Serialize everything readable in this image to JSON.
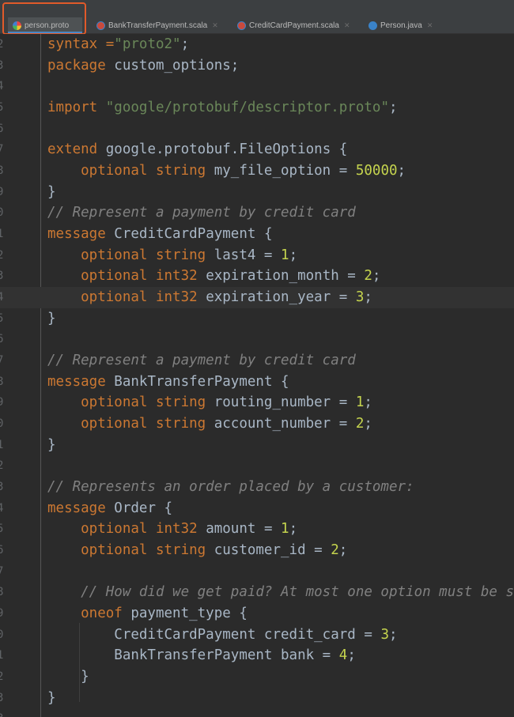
{
  "tabs": [
    {
      "label": "person.proto",
      "icon": "protobuf-file-icon",
      "active": true
    },
    {
      "label": "BankTransferPayment.scala",
      "icon": "scala-file-icon",
      "active": false
    },
    {
      "label": "CreditCardPayment.scala",
      "icon": "scala-file-icon",
      "active": false
    },
    {
      "label": "Person.java",
      "icon": "java-class-icon",
      "active": false
    }
  ],
  "editor": {
    "line_numbers": [
      "2",
      "3",
      "4",
      "5",
      "6",
      "7",
      "8",
      "9",
      "0",
      "1",
      "2",
      "3",
      "4",
      "5",
      "6",
      "7",
      "8",
      "9",
      "0",
      "1",
      "2",
      "3",
      "4",
      "5",
      "6",
      "7",
      "8",
      "9",
      "0",
      "1",
      "2",
      "3",
      "3"
    ],
    "lines": [
      [
        {
          "t": "syntax =",
          "c": "kw"
        },
        {
          "t": "\"proto2\"",
          "c": "str"
        },
        {
          "t": ";",
          "c": ""
        }
      ],
      [
        {
          "t": "package ",
          "c": "kw"
        },
        {
          "t": "custom_options;",
          "c": ""
        }
      ],
      [],
      [
        {
          "t": "import ",
          "c": "kw"
        },
        {
          "t": "\"google/protobuf/descriptor.proto\"",
          "c": "str"
        },
        {
          "t": ";",
          "c": ""
        }
      ],
      [],
      [
        {
          "t": "extend ",
          "c": "kw"
        },
        {
          "t": "google.protobuf.FileOptions {",
          "c": ""
        }
      ],
      [
        {
          "t": "    optional string ",
          "c": "kw"
        },
        {
          "t": "my_file_option = ",
          "c": ""
        },
        {
          "t": "50000",
          "c": "num-g"
        },
        {
          "t": ";",
          "c": ""
        }
      ],
      [
        {
          "t": "}",
          "c": ""
        }
      ],
      [
        {
          "t": "// Represent a payment by credit card",
          "c": "cm"
        }
      ],
      [
        {
          "t": "message ",
          "c": "kw"
        },
        {
          "t": "CreditCardPayment {",
          "c": ""
        }
      ],
      [
        {
          "t": "    optional string ",
          "c": "kw"
        },
        {
          "t": "last4 = ",
          "c": ""
        },
        {
          "t": "1",
          "c": "num-g"
        },
        {
          "t": ";",
          "c": ""
        }
      ],
      [
        {
          "t": "    optional int32 ",
          "c": "kw"
        },
        {
          "t": "expiration_month = ",
          "c": ""
        },
        {
          "t": "2",
          "c": "num-g"
        },
        {
          "t": ";",
          "c": ""
        }
      ],
      [
        {
          "t": "    optional int32 ",
          "c": "kw"
        },
        {
          "t": "expiration_year = ",
          "c": ""
        },
        {
          "t": "3",
          "c": "num-g"
        },
        {
          "t": ";",
          "c": ""
        }
      ],
      [
        {
          "t": "}",
          "c": ""
        }
      ],
      [],
      [
        {
          "t": "// Represent a payment by credit card",
          "c": "cm"
        }
      ],
      [
        {
          "t": "message ",
          "c": "kw"
        },
        {
          "t": "BankTransferPayment {",
          "c": ""
        }
      ],
      [
        {
          "t": "    optional string ",
          "c": "kw"
        },
        {
          "t": "routing_number = ",
          "c": ""
        },
        {
          "t": "1",
          "c": "num-g"
        },
        {
          "t": ";",
          "c": ""
        }
      ],
      [
        {
          "t": "    optional string ",
          "c": "kw"
        },
        {
          "t": "account_number = ",
          "c": ""
        },
        {
          "t": "2",
          "c": "num-g"
        },
        {
          "t": ";",
          "c": ""
        }
      ],
      [
        {
          "t": "}",
          "c": ""
        }
      ],
      [],
      [
        {
          "t": "// Represents an order placed by a customer:",
          "c": "cm"
        }
      ],
      [
        {
          "t": "message ",
          "c": "kw"
        },
        {
          "t": "Order {",
          "c": ""
        }
      ],
      [
        {
          "t": "    optional int32 ",
          "c": "kw"
        },
        {
          "t": "amount = ",
          "c": ""
        },
        {
          "t": "1",
          "c": "num-g"
        },
        {
          "t": ";",
          "c": ""
        }
      ],
      [
        {
          "t": "    optional string ",
          "c": "kw"
        },
        {
          "t": "customer_id = ",
          "c": ""
        },
        {
          "t": "2",
          "c": "num-g"
        },
        {
          "t": ";",
          "c": ""
        }
      ],
      [],
      [
        {
          "t": "    // How did we get paid? At most one option must be set",
          "c": "cm"
        }
      ],
      [
        {
          "t": "    oneof ",
          "c": "kw"
        },
        {
          "t": "payment_type {",
          "c": ""
        }
      ],
      [
        {
          "t": "        CreditCardPayment credit_card = ",
          "c": ""
        },
        {
          "t": "3",
          "c": "num-g"
        },
        {
          "t": ";",
          "c": ""
        }
      ],
      [
        {
          "t": "        BankTransferPayment bank = ",
          "c": ""
        },
        {
          "t": "4",
          "c": "num-g"
        },
        {
          "t": ";",
          "c": ""
        }
      ],
      [
        {
          "t": "    }",
          "c": ""
        }
      ],
      [
        {
          "t": "}",
          "c": ""
        }
      ]
    ]
  },
  "colors": {
    "keyword": "#cc7832",
    "string": "#6a8759",
    "number": "#c5d44e",
    "comment": "#808080",
    "text": "#a9b7c6",
    "background": "#2b2b2b",
    "highlight_border": "#e15a2a"
  }
}
